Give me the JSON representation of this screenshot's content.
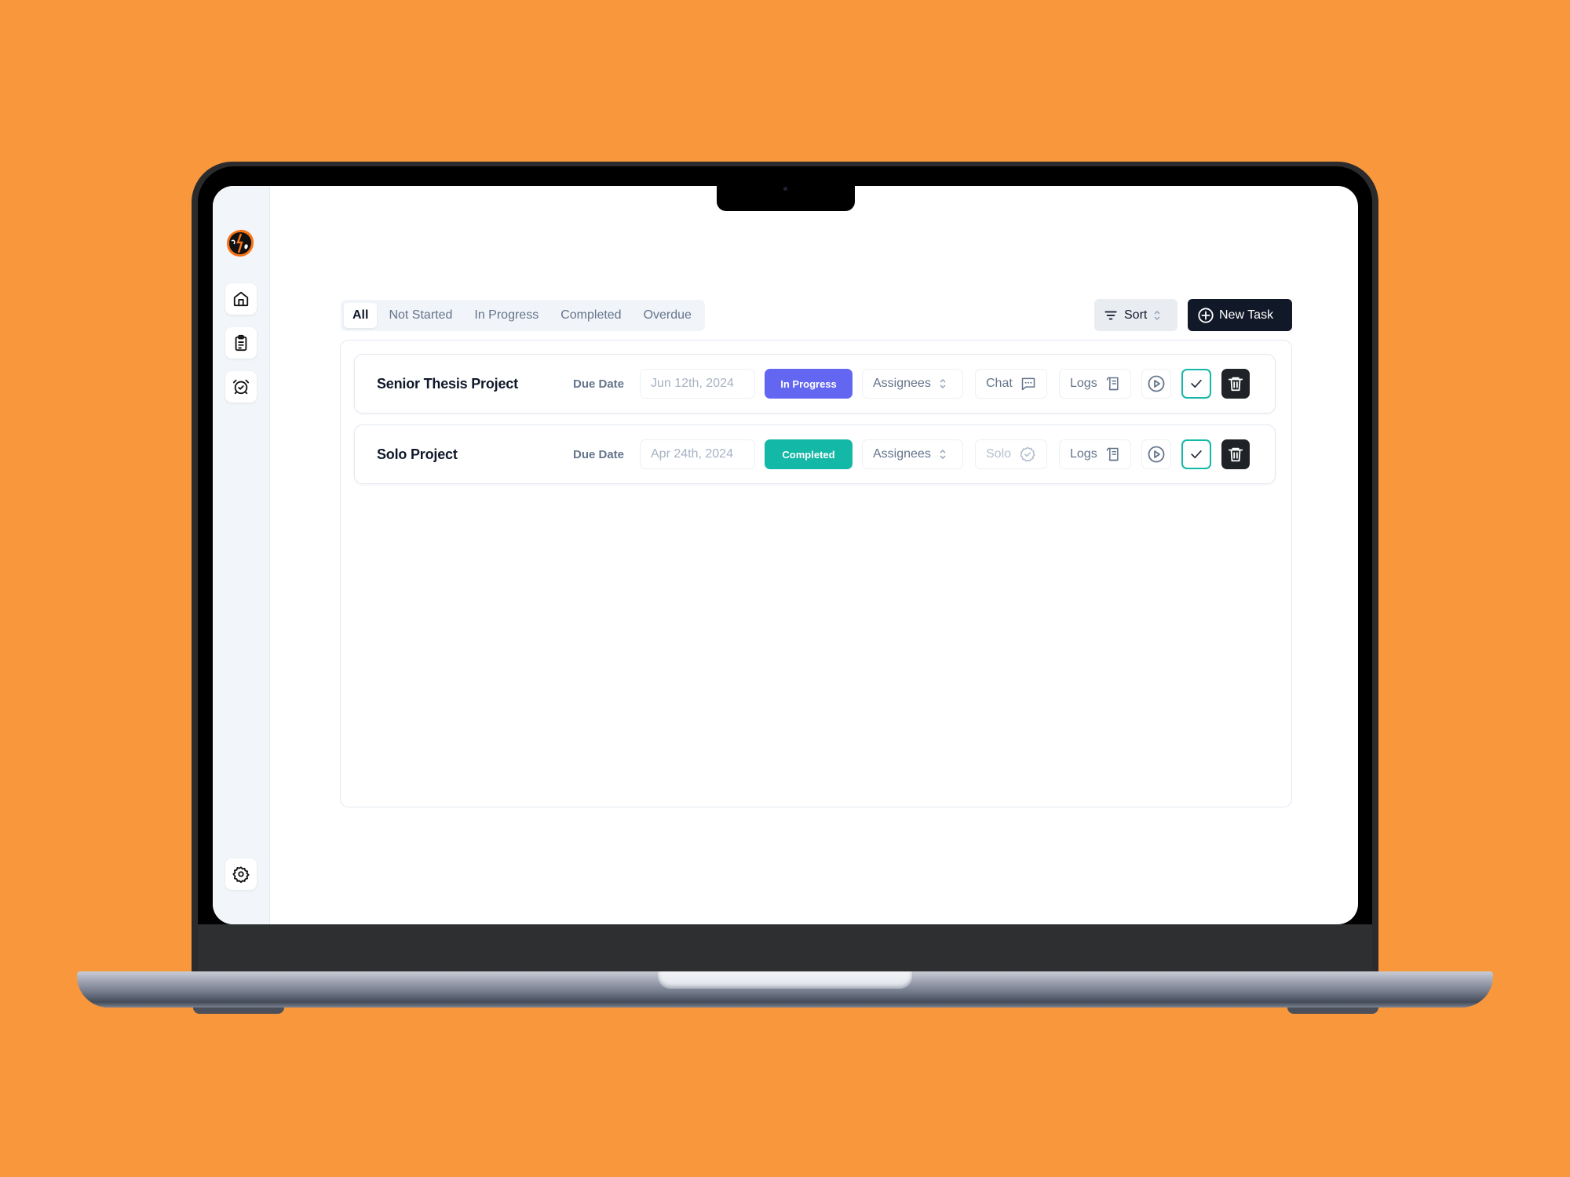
{
  "tabs": [
    {
      "label": "All",
      "active": true
    },
    {
      "label": "Not Started",
      "active": false
    },
    {
      "label": "In Progress",
      "active": false
    },
    {
      "label": "Completed",
      "active": false
    },
    {
      "label": "Overdue",
      "active": false
    }
  ],
  "toolbar": {
    "sort_label": "Sort",
    "new_task_label": "New Task"
  },
  "sidebar": {
    "items": [
      {
        "icon": "home-icon"
      },
      {
        "icon": "clipboard-list-icon"
      },
      {
        "icon": "alarm-clock-check-icon"
      }
    ],
    "bottom": {
      "icon": "gear-icon"
    }
  },
  "colors": {
    "background": "#f8973c",
    "in_progress": "#6366f1",
    "completed": "#14b8a6",
    "primary_button": "#111827",
    "trash_button": "#1f2328"
  },
  "tasks": [
    {
      "title": "Senior Thesis Project",
      "due_label": "Due Date",
      "due_date": "Jun 12th, 2024",
      "status": "In Progress",
      "status_color": "#6366f1",
      "assignees_label": "Assignees",
      "chat_label": "Chat",
      "chat_icon": "message-square-icon",
      "logs_label": "Logs"
    },
    {
      "title": "Solo Project",
      "due_label": "Due Date",
      "due_date": "Apr 24th, 2024",
      "status": "Completed",
      "status_color": "#14b8a6",
      "assignees_label": "Assignees",
      "chat_label": "Solo",
      "chat_icon": "badge-check-icon",
      "logs_label": "Logs"
    }
  ]
}
